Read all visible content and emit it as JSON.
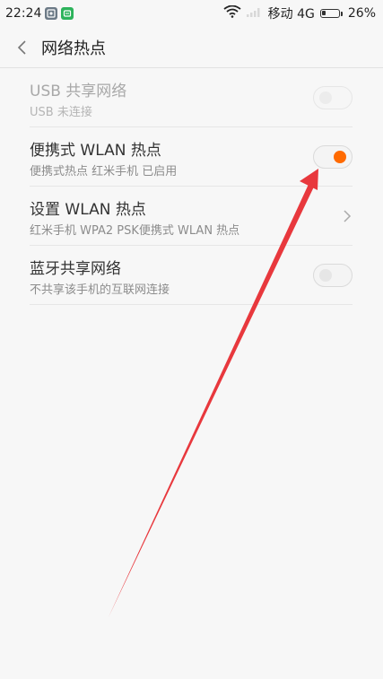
{
  "status": {
    "time": "22:24",
    "carrier": "移动 4G",
    "battery_text": "26%",
    "battery_level": 0.26
  },
  "header": {
    "title": "网络热点"
  },
  "items": [
    {
      "title": "USB 共享网络",
      "subtitle": "USB 未连接",
      "control": "switch",
      "on": false,
      "enabled": false
    },
    {
      "title": "便携式 WLAN 热点",
      "subtitle": "便携式热点 红米手机 已启用",
      "control": "switch",
      "on": true,
      "enabled": true
    },
    {
      "title": "设置 WLAN 热点",
      "subtitle": "红米手机 WPA2 PSK便携式 WLAN 热点",
      "control": "chevron",
      "enabled": true
    },
    {
      "title": "蓝牙共享网络",
      "subtitle": "不共享该手机的互联网连接",
      "control": "switch",
      "on": false,
      "enabled": true
    }
  ],
  "colors": {
    "accent": "#ff6a00",
    "annotation": "#e8383d"
  }
}
